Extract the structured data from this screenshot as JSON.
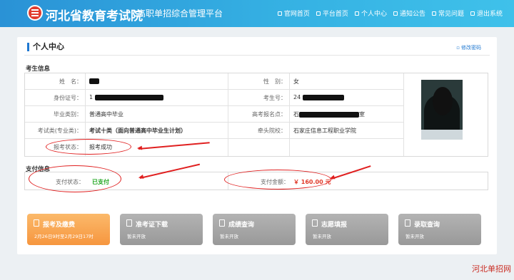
{
  "header": {
    "site_title": "河北省教育考试院",
    "site_subtitle": "高职单招综合管理平台",
    "nav": [
      "官网首页",
      "平台首页",
      "个人中心",
      "通知公告",
      "常见问题",
      "退出系统"
    ]
  },
  "page": {
    "title": "个人中心",
    "change_password": "修改密码"
  },
  "examinee": {
    "section_title": "考生信息",
    "name_label": "姓　名：",
    "gender_label": "性　别：",
    "gender_value": "女",
    "id_label": "身份证号：",
    "id_value": "1",
    "exam_no_label": "考生号：",
    "exam_no_value": "24",
    "grad_type_label": "毕业类别：",
    "grad_type_value": "普通高中毕业",
    "reg_site_label": "高考报名点：",
    "reg_site_value_prefix": "石",
    "reg_site_value_suffix": "室",
    "category_label": "考试类(专业类)：",
    "category_value": "考试十类（面向普通高中毕业生计划）",
    "lead_school_label": "牵头院校：",
    "lead_school_value": "石家庄信息工程职业学院",
    "status_label": "报考状态：",
    "status_value": "报考成功"
  },
  "payment": {
    "section_title": "支付信息",
    "status_label": "支付状态：",
    "status_value": "已支付",
    "amount_label": "支付金额：",
    "amount_value": "￥ 160.00 元"
  },
  "tiles": [
    {
      "title": "报考及缴费",
      "sub": "2月26日9时至2月29日17时",
      "active": true
    },
    {
      "title": "准考证下载",
      "sub": "暂未开放",
      "active": false
    },
    {
      "title": "成绩查询",
      "sub": "暂未开放",
      "active": false
    },
    {
      "title": "志愿填报",
      "sub": "暂未开放",
      "active": false
    },
    {
      "title": "录取查询",
      "sub": "暂未开放",
      "active": false
    }
  ],
  "watermark": "河北单招网",
  "colors": {
    "primary": "#2a92d6",
    "accent_orange": "#f6963f",
    "annotation_red": "#e02020",
    "paid_green": "#1ea51e"
  }
}
